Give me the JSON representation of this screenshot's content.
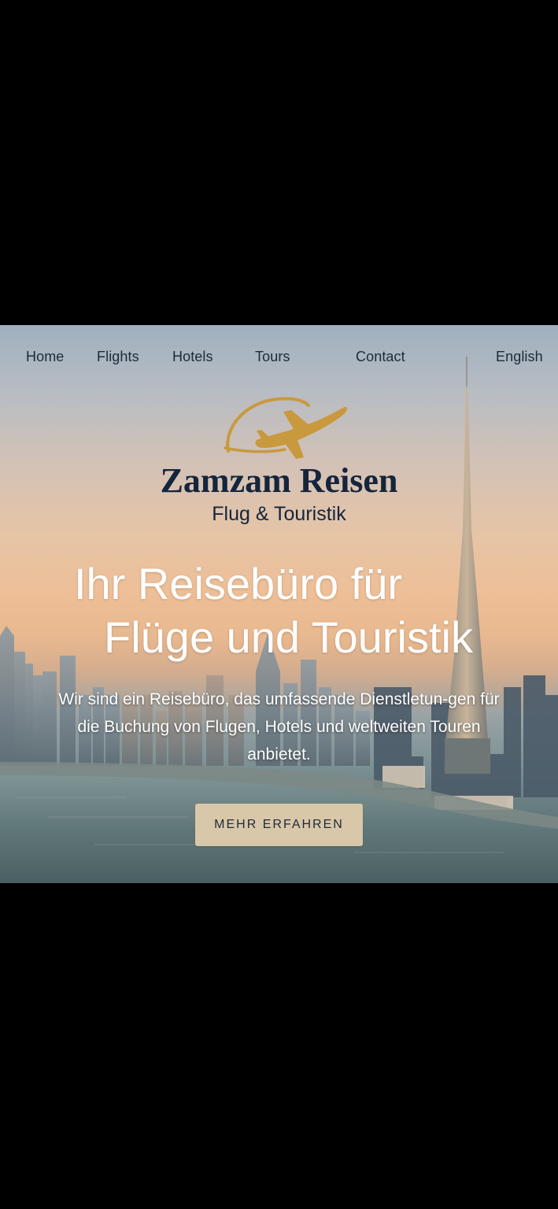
{
  "nav": {
    "items": [
      {
        "label": "Home"
      },
      {
        "label": "Flights"
      },
      {
        "label": "Hotels"
      },
      {
        "label": "Tours"
      },
      {
        "label": "Contact"
      }
    ],
    "language": "English"
  },
  "brand": {
    "name": "Zamzam Reisen",
    "tagline": "Flug & Touristik",
    "logo_icon": "airplane-swoosh-icon",
    "logo_color": "#c9993e",
    "text_color": "#14253d"
  },
  "hero": {
    "headline_line1": "Ihr Reisebüro für",
    "headline_line2": "Flüge und Touristik",
    "description": "Wir sind ein Reisebüro, das umfassende Dienstletun-gen für die Buchung von Flugen, Hotels und weltweiten Touren anbietet.",
    "cta_label": "MEHR ERFAHREN",
    "cta_color": "#d8c7a8"
  }
}
